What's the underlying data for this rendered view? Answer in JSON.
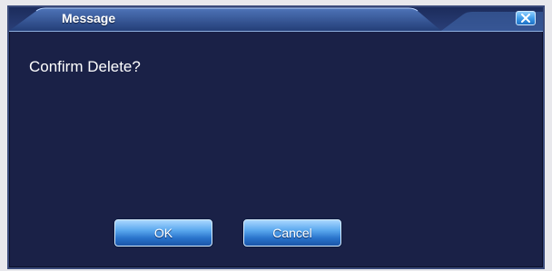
{
  "dialog": {
    "title": "Message",
    "message": "Confirm Delete?",
    "close_icon": "close-icon",
    "buttons": {
      "ok_label": "OK",
      "cancel_label": "Cancel"
    }
  },
  "colors": {
    "dialog_background": "#1a2147",
    "title_bar": "#3d5f9e",
    "button": "#5aa8ee",
    "text": "#ffffff"
  }
}
